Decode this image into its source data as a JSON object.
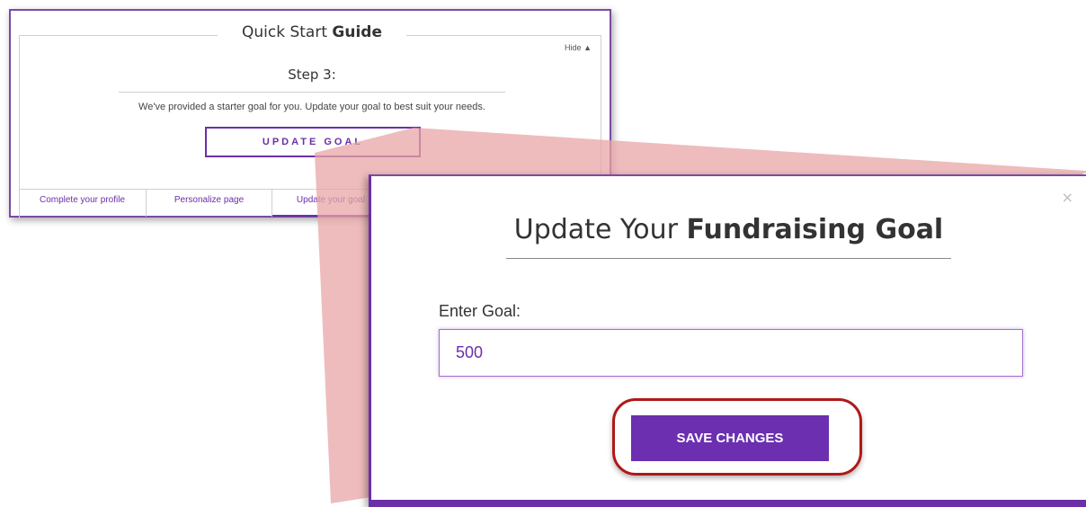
{
  "quick_start": {
    "title_plain": "Quick Start",
    "title_bold": "Guide",
    "hide_label": "Hide",
    "hide_icon": "triangle-up-icon",
    "step_label": "Step 3:",
    "description": "We've provided a starter goal for you. Update your goal to best suit your needs.",
    "update_button": "UPDATE GOAL",
    "tabs": [
      {
        "label": "Complete your profile"
      },
      {
        "label": "Personalize page"
      },
      {
        "label": "Update your goal"
      }
    ]
  },
  "modal": {
    "title_plain": "Update Your",
    "title_bold": "Fundraising Goal",
    "close_icon": "close-icon",
    "goal_label": "Enter Goal:",
    "goal_value": "500",
    "save_button": "SAVE CHANGES"
  },
  "colors": {
    "brand_purple": "#6b2fb0",
    "highlight_ring": "#b01818",
    "connector": "#e8a6a6"
  }
}
